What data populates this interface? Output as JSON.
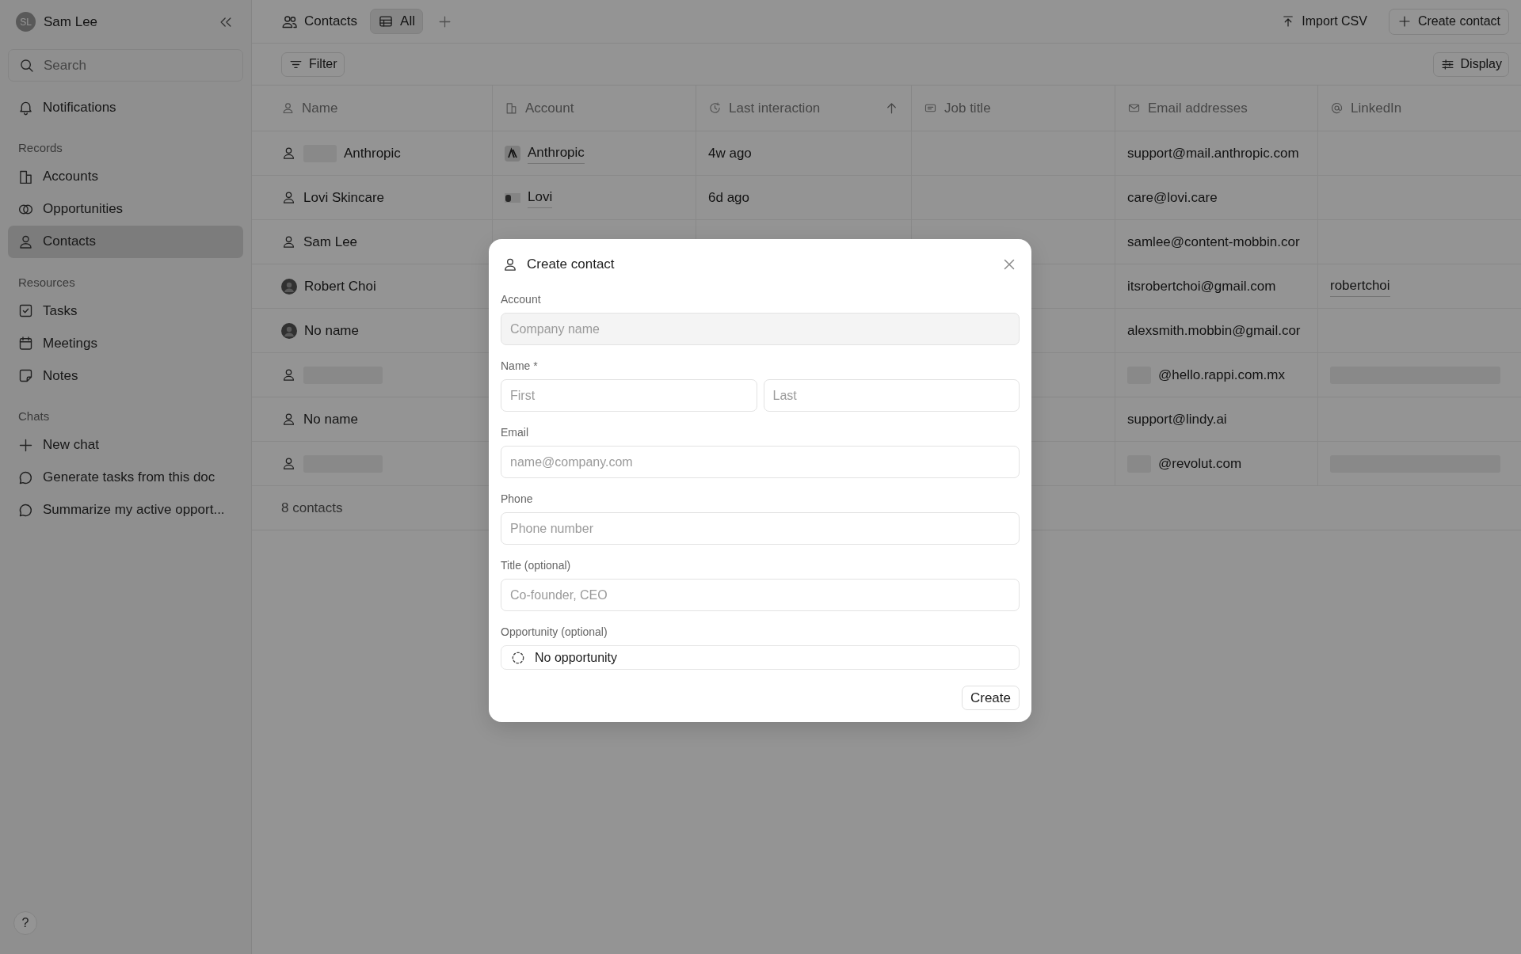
{
  "sidebar": {
    "user": {
      "initials": "SL",
      "name": "Sam Lee"
    },
    "search": {
      "placeholder": "Search"
    },
    "sections": [
      {
        "items": [
          {
            "label": "Notifications",
            "selected": false
          }
        ]
      },
      {
        "title": "Records",
        "items": [
          {
            "label": "Accounts",
            "selected": false
          },
          {
            "label": "Opportunities",
            "selected": false
          },
          {
            "label": "Contacts",
            "selected": true
          }
        ]
      },
      {
        "title": "Resources",
        "items": [
          {
            "label": "Tasks",
            "selected": false
          },
          {
            "label": "Meetings",
            "selected": false
          },
          {
            "label": "Notes",
            "selected": false
          }
        ]
      },
      {
        "title": "Chats",
        "items": [
          {
            "label": "New chat",
            "selected": false
          },
          {
            "label": "Generate tasks from this doc",
            "selected": false
          },
          {
            "label": "Summarize my active opport...",
            "selected": false
          }
        ]
      }
    ],
    "help": "?"
  },
  "header": {
    "title": "Contacts",
    "views": [
      {
        "label": "All",
        "selected": true
      }
    ],
    "actions": [
      {
        "label": "Import CSV",
        "outlined": false
      },
      {
        "label": "Create contact",
        "outlined": true
      }
    ]
  },
  "toolbar": {
    "filter": "Filter",
    "display": "Display"
  },
  "table": {
    "columns": [
      {
        "label": "Name",
        "sorted": false
      },
      {
        "label": "Account",
        "sorted": false
      },
      {
        "label": "Last interaction",
        "sorted": true
      },
      {
        "label": "Job title",
        "sorted": false
      },
      {
        "label": "Email addresses",
        "sorted": false
      },
      {
        "label": "LinkedIn",
        "sorted": false
      }
    ],
    "rows": [
      {
        "kind": "person",
        "name": "Anthropic",
        "name_masked": true,
        "account": {
          "kind": "mark",
          "name": "Anthropic"
        },
        "last_interaction": "4w ago",
        "email": "support@mail.anthropic.com"
      },
      {
        "kind": "person",
        "name": "Lovi Skincare",
        "account": {
          "kind": "image",
          "name": "Lovi"
        },
        "last_interaction": "6d ago",
        "email": "care@lovi.care"
      },
      {
        "kind": "person",
        "name": "Sam Lee",
        "email": "samlee@content-mobbin.cor"
      },
      {
        "kind": "photo",
        "name": "Robert Choi",
        "email": "itsrobertchoi@gmail.com",
        "linkedin": "robertchoi"
      },
      {
        "kind": "photo",
        "name": "No name",
        "email": "alexsmith.mobbin@gmail.cor"
      },
      {
        "kind": "person",
        "name_masked": true,
        "email": "@hello.rappi.com.mx",
        "email_masked": true,
        "linkedin_masked": true
      },
      {
        "kind": "person",
        "name": "No name",
        "email": "support@lindy.ai"
      },
      {
        "kind": "person",
        "name_masked": true,
        "email": "@revolut.com",
        "email_masked": true,
        "linkedin_masked": true
      }
    ],
    "footer": "8 contacts"
  },
  "dialog": {
    "title": "Create contact",
    "fields": [
      {
        "label": "Account",
        "inputs": [
          {
            "placeholder": "Company name",
            "disabled": true
          }
        ]
      },
      {
        "label": "Name *",
        "inputs": [
          {
            "placeholder": "First",
            "disabled": false
          },
          {
            "placeholder": "Last",
            "disabled": false
          }
        ]
      },
      {
        "label": "Email",
        "inputs": [
          {
            "placeholder": "name@company.com",
            "disabled": false
          }
        ]
      },
      {
        "label": "Phone",
        "inputs": [
          {
            "placeholder": "Phone number",
            "disabled": false
          }
        ]
      },
      {
        "label": "Title (optional)",
        "inputs": [
          {
            "placeholder": "Co-founder, CEO",
            "disabled": false
          }
        ]
      }
    ],
    "opportunity": {
      "label": "Opportunity (optional)",
      "value": "No opportunity"
    },
    "submit": "Create"
  }
}
